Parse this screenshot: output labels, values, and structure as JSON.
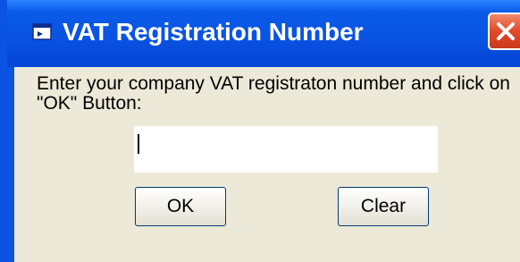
{
  "window": {
    "title": "VAT Registration Number",
    "title_icon": "dialog-window-icon",
    "close_icon": "close-icon"
  },
  "form": {
    "prompt": "Enter your company VAT registraton number and click on \"OK\" Button:",
    "vat_input": {
      "value": "",
      "placeholder": ""
    }
  },
  "buttons": {
    "ok_label": "OK",
    "clear_label": "Clear"
  },
  "colors": {
    "titlebar": "#0a53e3",
    "client_bg": "#ece9d8",
    "close_button": "#e0492a"
  }
}
